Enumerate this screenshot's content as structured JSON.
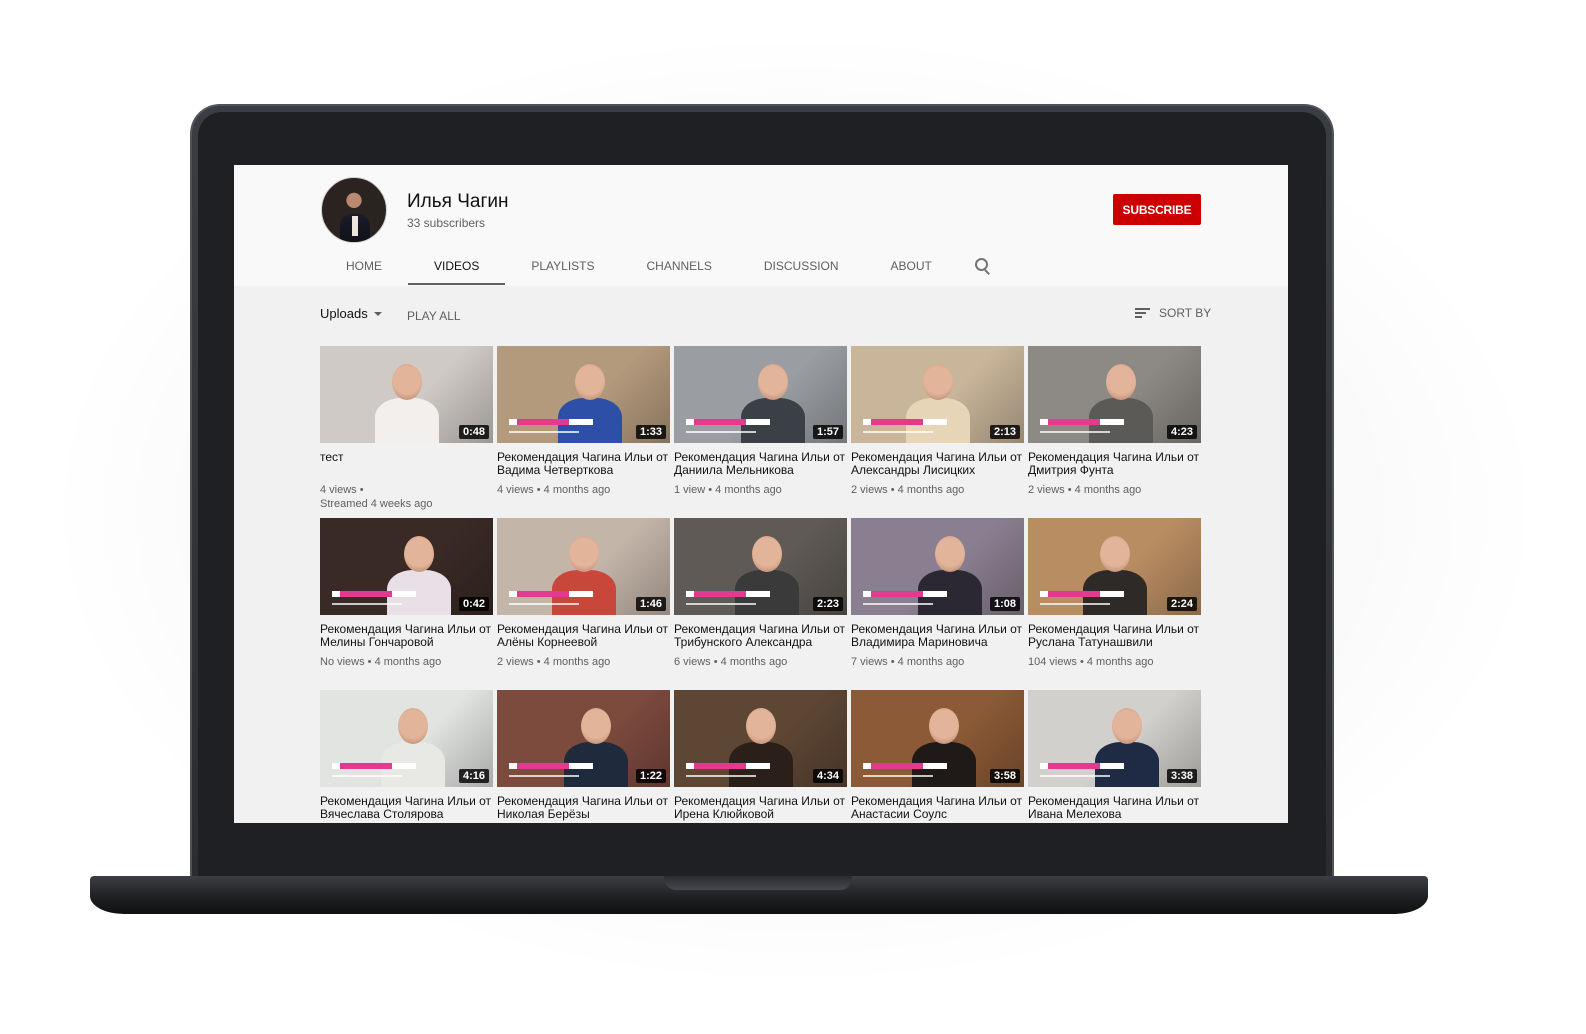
{
  "channel": {
    "name": "Илья Чагин",
    "subscribers": "33 subscribers",
    "subscribe_label": "SUBSCRIBE"
  },
  "tabs": [
    {
      "label": "HOME"
    },
    {
      "label": "VIDEOS",
      "active": true
    },
    {
      "label": "PLAYLISTS"
    },
    {
      "label": "CHANNELS"
    },
    {
      "label": "DISCUSSION"
    },
    {
      "label": "ABOUT"
    }
  ],
  "subbar": {
    "uploads_label": "Uploads",
    "play_all_label": "PLAY ALL",
    "sort_label": "SORT BY"
  },
  "videos": [
    {
      "title": "тест",
      "duration": "0:48",
      "meta": "4 views •",
      "meta2": "Streamed 4 weeks ago",
      "bg": "#cfcac6",
      "torso": "#f2efec"
    },
    {
      "title": "Рекомендация Чагина Ильи от Вадима Четвертковa",
      "duration": "1:33",
      "meta": "4 views • 4 months ago",
      "bg": "#b49a7c",
      "torso": "#2d4fa8"
    },
    {
      "title": "Рекомендация Чагина Ильи от Даниила Мельникова",
      "duration": "1:57",
      "meta": "1 view • 4 months ago",
      "bg": "#9a9ea2",
      "torso": "#3b4046"
    },
    {
      "title": "Рекомендация Чагина Ильи от Александры Лисицких",
      "duration": "2:13",
      "meta": "2 views • 4 months ago",
      "bg": "#c9b59a",
      "torso": "#e7d5b8"
    },
    {
      "title": "Рекомендация Чагина Ильи от Дмитрия Фунта",
      "duration": "4:23",
      "meta": "2 views • 4 months ago",
      "bg": "#8d8984",
      "torso": "#5c5a57"
    },
    {
      "title": "Рекомендация Чагина Ильи от Мелины Гончаровой",
      "duration": "0:42",
      "meta": "No views • 4 months ago",
      "bg": "#3a2a26",
      "torso": "#e9dfe6"
    },
    {
      "title": "Рекомендация Чагина Ильи от Алёны Корнеевой",
      "duration": "1:46",
      "meta": "2 views • 4 months ago",
      "bg": "#c4b5a9",
      "torso": "#c9463b"
    },
    {
      "title": "Рекомендация Чагина Ильи от Трибунского Александра",
      "duration": "2:23",
      "meta": "6 views • 4 months ago",
      "bg": "#5f5a55",
      "torso": "#3a3a3a"
    },
    {
      "title": "Рекомендация Чагина Ильи от Владимира Мариновича",
      "duration": "1:08",
      "meta": "7 views • 4 months ago",
      "bg": "#8a7f90",
      "torso": "#2c2833"
    },
    {
      "title": "Рекомендация Чагина Ильи от Руслана Татунашвили",
      "duration": "2:24",
      "meta": "104 views • 4 months ago",
      "bg": "#b98d62",
      "torso": "#2e2a27"
    },
    {
      "title": "Рекомендация Чагина Ильи от Вячеслава Столярова",
      "duration": "4:16",
      "meta": "",
      "bg": "#e2e4e2",
      "torso": "#e8e8e4"
    },
    {
      "title": "Рекомендация Чагина Ильи от Николая Берёзы",
      "duration": "1:22",
      "meta": "",
      "bg": "#7d4a3e",
      "torso": "#1f2a3c"
    },
    {
      "title": "Рекомендация Чагина Ильи от Ирена Клюйковой",
      "duration": "4:34",
      "meta": "",
      "bg": "#5e4634",
      "torso": "#2b1f1a"
    },
    {
      "title": "Рекомендация Чагина Ильи от Анастасии Соулс",
      "duration": "3:58",
      "meta": "",
      "bg": "#8c5a36",
      "torso": "#1f1a18"
    },
    {
      "title": "Рекомендация Чагина Ильи от Ивана Мелехова",
      "duration": "3:38",
      "meta": "",
      "bg": "#d2d0cc",
      "torso": "#1f2b45"
    }
  ]
}
